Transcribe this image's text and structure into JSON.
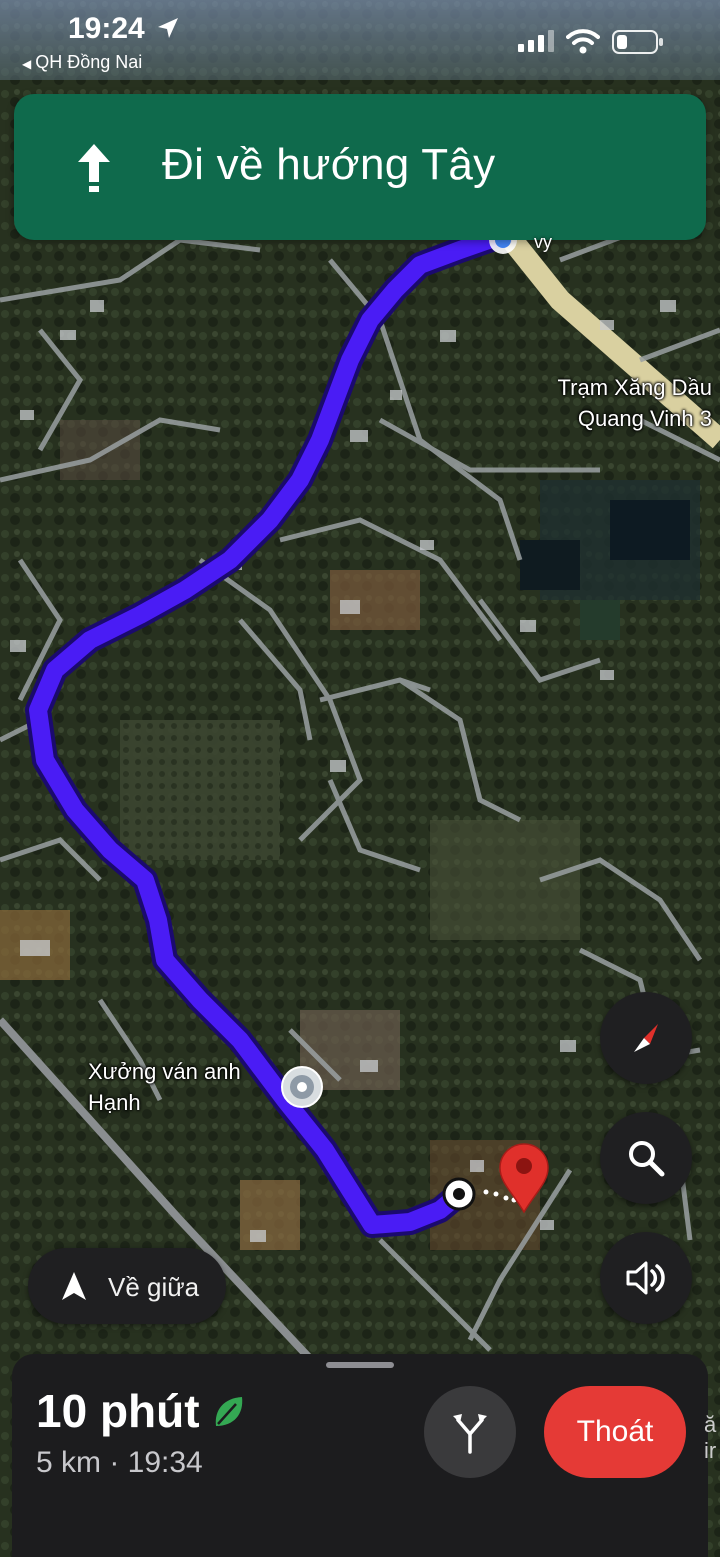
{
  "status_bar": {
    "time": "19:24",
    "back_app": "QH Đồng Nai"
  },
  "navigation": {
    "instruction": "Đi về hướng Tây"
  },
  "map": {
    "labels": {
      "gas_station_line1": "Trạm Xăng Dầu",
      "gas_station_line2": "Quang Vinh 3",
      "workshop_line1": "Xưởng ván anh",
      "workshop_line2": "Hạnh",
      "road_fragment": "vy"
    },
    "colors": {
      "route": "#4a1cf5",
      "banner": "#0f6a4c",
      "destination_pin": "#e0302b"
    }
  },
  "controls": {
    "recenter_label": "Về giữa",
    "compass_icon": "compass-icon",
    "search_icon": "search-icon",
    "sound_icon": "volume-icon"
  },
  "trip": {
    "duration": "10 phút",
    "details": "5 km · 19:34",
    "exit_label": "Thoát",
    "edge_fragment_1": "ă",
    "edge_fragment_2": "ir"
  }
}
